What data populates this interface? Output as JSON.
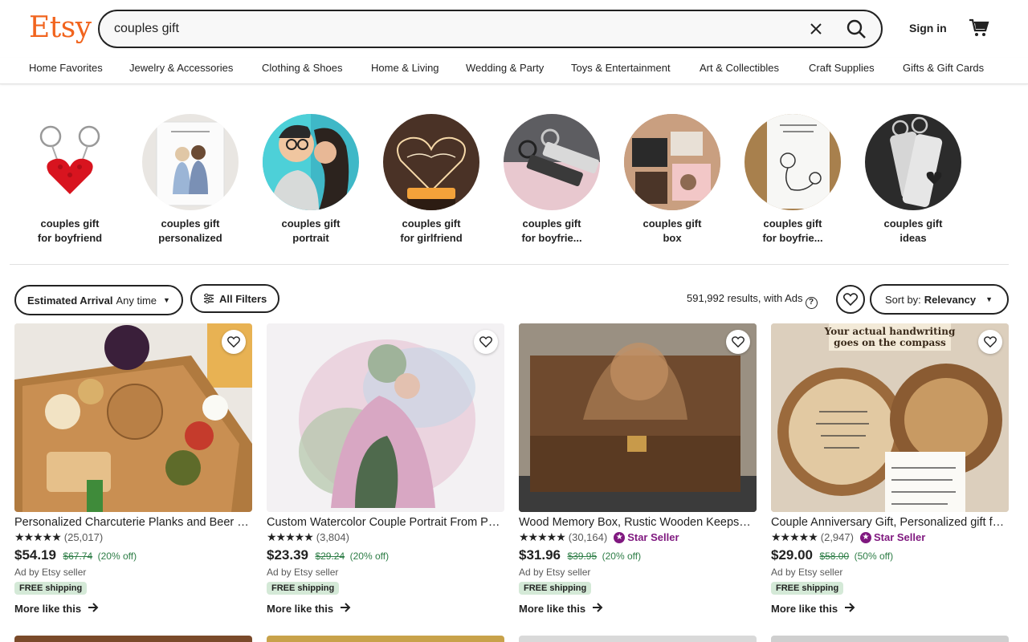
{
  "brand": {
    "logo": "Etsy",
    "color": "#f1641e"
  },
  "search": {
    "value": "couples gift",
    "clear_icon": "close-icon",
    "search_icon": "search-icon"
  },
  "account": {
    "sign_in": "Sign in",
    "cart_icon": "cart-icon"
  },
  "nav": [
    "Home Favorites",
    "Jewelry & Accessories",
    "Clothing & Shoes",
    "Home & Living",
    "Wedding & Party",
    "Toys & Entertainment",
    "Art & Collectibles",
    "Craft Supplies",
    "Gifts & Gift Cards"
  ],
  "categories": [
    {
      "line1": "couples gift",
      "line2": "for boyfriend"
    },
    {
      "line1": "couples gift",
      "line2": "personalized"
    },
    {
      "line1": "couples gift",
      "line2": "portrait"
    },
    {
      "line1": "couples gift",
      "line2": "for girlfriend"
    },
    {
      "line1": "couples gift",
      "line2": "for boyfrie..."
    },
    {
      "line1": "couples gift",
      "line2": "box"
    },
    {
      "line1": "couples gift",
      "line2": "for boyfrie..."
    },
    {
      "line1": "couples gift",
      "line2": "ideas"
    }
  ],
  "filters": {
    "arrival_label": "Estimated Arrival",
    "arrival_value": "Any time",
    "all_filters": "All Filters",
    "results": "591,992 results, with Ads",
    "sort_label": "Sort by:",
    "sort_value": "Relevancy"
  },
  "products": [
    {
      "title": "Personalized Charcuterie Planks and Beer Serving Boards",
      "reviews": "(25,017)",
      "star_seller": "",
      "price": "$54.19",
      "original": "$67.74",
      "discount": "(20% off)",
      "ad": "Ad by Etsy seller",
      "shipping": "FREE shipping",
      "more": "More like this"
    },
    {
      "title": "Custom Watercolor Couple Portrait From Photo",
      "reviews": "(3,804)",
      "star_seller": "",
      "price": "$23.39",
      "original": "$29.24",
      "discount": "(20% off)",
      "ad": "Ad by Etsy seller",
      "shipping": "FREE shipping",
      "more": "More like this"
    },
    {
      "title": "Wood Memory Box, Rustic Wooden Keepsake Box",
      "reviews": "(30,164)",
      "star_seller": "Star Seller",
      "price": "$31.96",
      "original": "$39.95",
      "discount": "(20% off)",
      "ad": "Ad by Etsy seller",
      "shipping": "FREE shipping",
      "more": "More like this"
    },
    {
      "title": "Couple Anniversary Gift, Personalized gift for him",
      "reviews": "(2,947)",
      "star_seller": "Star Seller",
      "price": "$29.00",
      "original": "$58.00",
      "discount": "(50% off)",
      "ad": "Ad by Etsy seller",
      "shipping": "FREE shipping",
      "more": "More like this"
    }
  ],
  "compass_text": {
    "banner": "Your actual handwriting goes on the compass"
  }
}
